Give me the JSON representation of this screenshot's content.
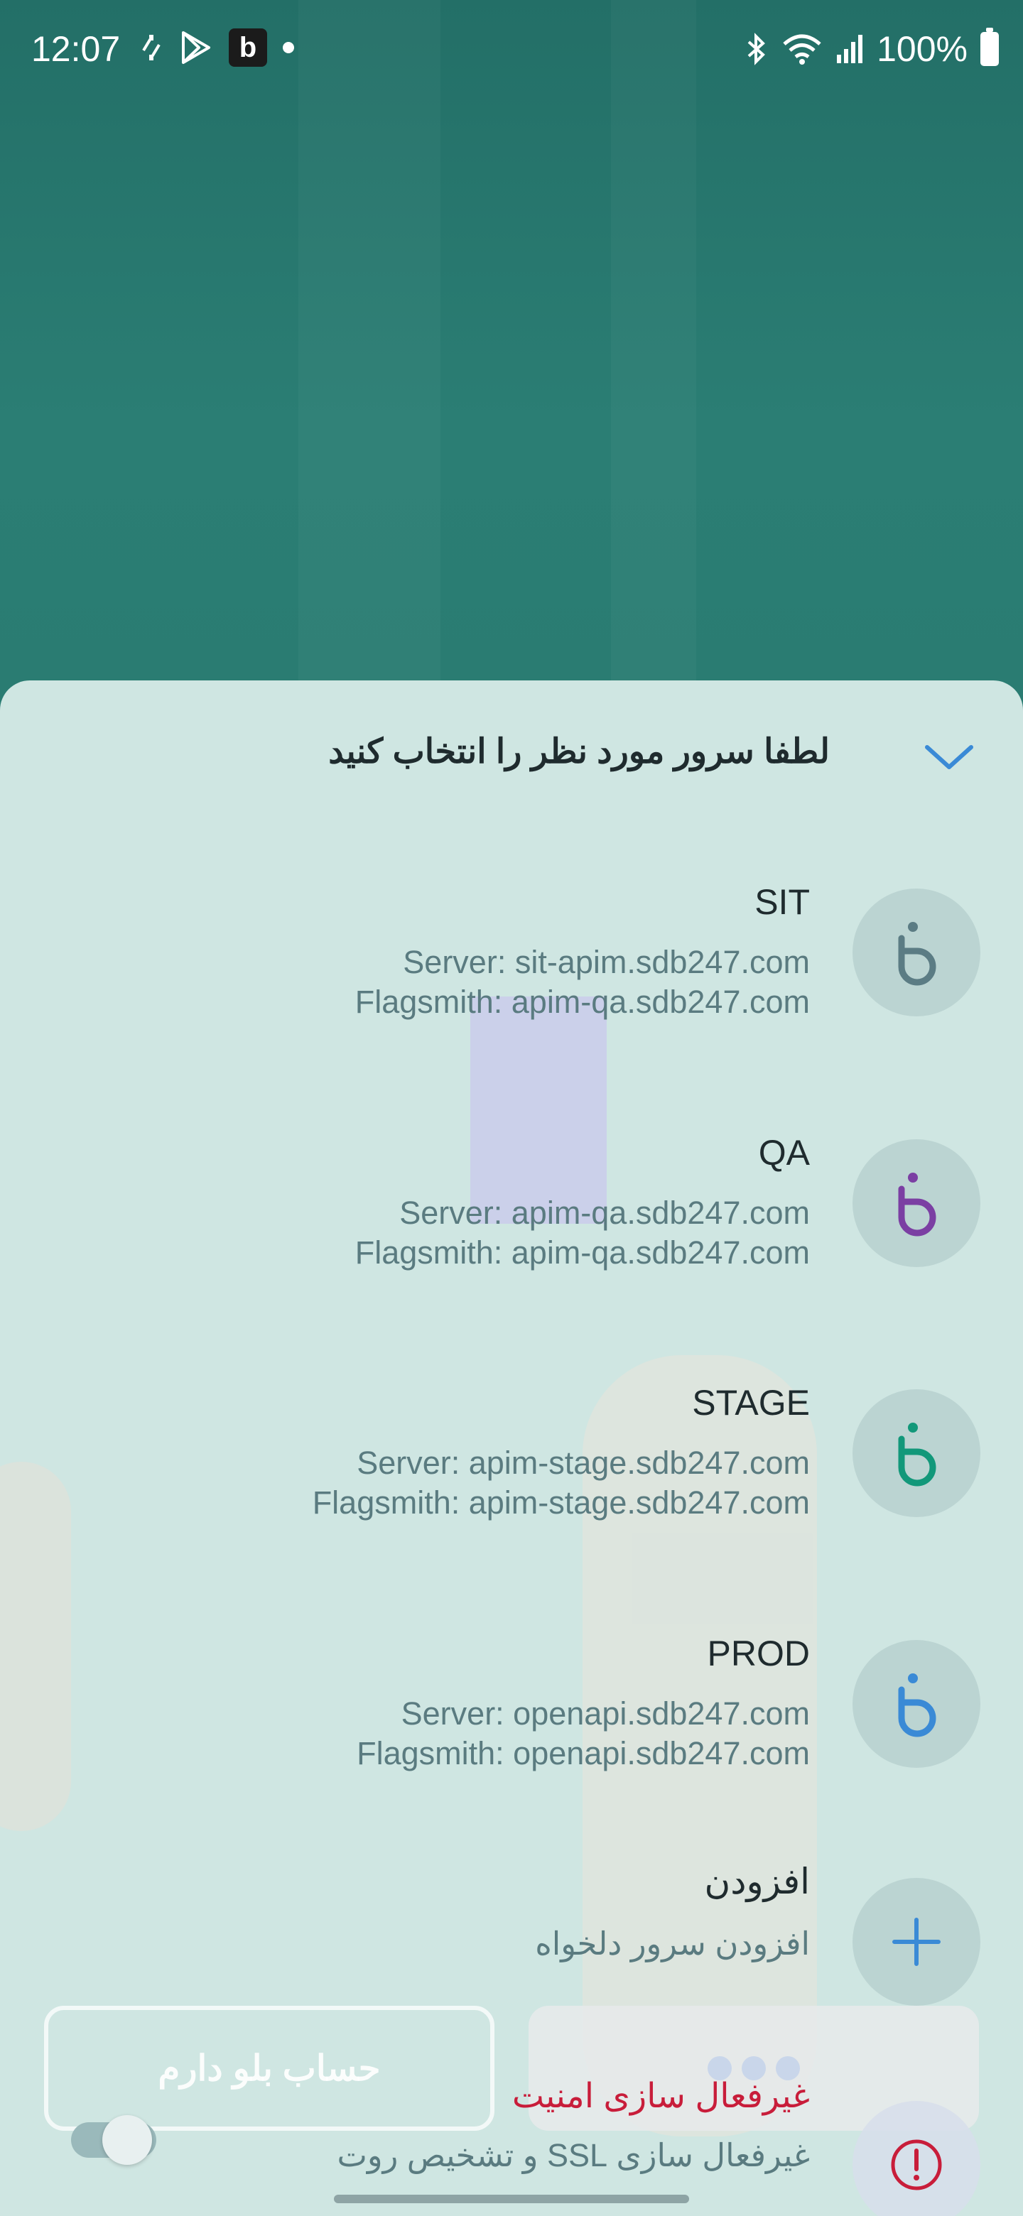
{
  "status_bar": {
    "time": "12:07",
    "battery": "100%",
    "app_badge_letter": "b",
    "icons": [
      "sync-icon",
      "play-store-icon",
      "app-badge-icon",
      "dot-icon",
      "bluetooth-icon",
      "wifi-icon",
      "signal-icon",
      "battery-icon"
    ]
  },
  "sheet": {
    "title": "لطفا سرور مورد نظر را انتخاب کنید",
    "collapse_icon": "chevron-down-icon"
  },
  "servers": [
    {
      "name": "SIT",
      "server": "Server: sit-apim.sdb247.com",
      "flagsmith": "Flagsmith: apim-qa.sdb247.com",
      "icon_color": "#5b7c84"
    },
    {
      "name": "QA",
      "server": "Server: apim-qa.sdb247.com",
      "flagsmith": "Flagsmith: apim-qa.sdb247.com",
      "icon_color": "#7b3fa3"
    },
    {
      "name": "STAGE",
      "server": "Server: apim-stage.sdb247.com",
      "flagsmith": "Flagsmith: apim-stage.sdb247.com",
      "icon_color": "#12987a"
    },
    {
      "name": "PROD",
      "server": "Server: openapi.sdb247.com",
      "flagsmith": "Flagsmith: openapi.sdb247.com",
      "icon_color": "#3a8ad6"
    }
  ],
  "add_server": {
    "title": "افزودن",
    "subtitle": "افزودن سرور دلخواه"
  },
  "buttons": {
    "have_account": "حساب بلو دارم"
  },
  "security": {
    "title": "غیرفعال سازی امنیت",
    "subtitle": "غیرفعال سازی SSL و تشخیص روت"
  },
  "colors": {
    "accent": "#3a8ad6",
    "danger": "#c81d3a",
    "header_bg": "#2a7d73",
    "sheet_bg": "#cfe6e2"
  }
}
